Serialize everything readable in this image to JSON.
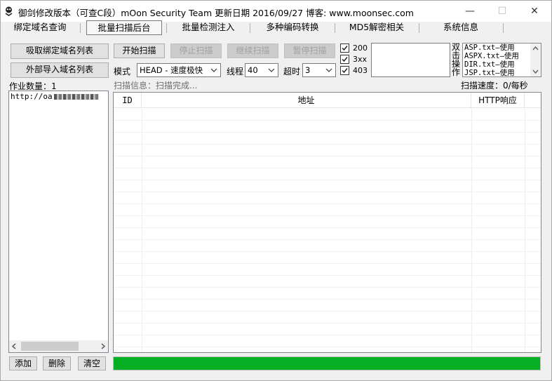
{
  "window": {
    "title": "御剑修改版本（可查C段）mOon Security Team 更新日期 2016/09/27 博客: www.moonsec.com",
    "controls": {
      "minimize": "—",
      "maximize": "☐",
      "close": "✕"
    }
  },
  "tabs": [
    {
      "label": "绑定域名查询",
      "active": false
    },
    {
      "label": "批量扫描后台",
      "active": true
    },
    {
      "label": "批量检测注入",
      "active": false
    },
    {
      "label": "多种编码转换",
      "active": false
    },
    {
      "label": "MD5解密相关",
      "active": false
    },
    {
      "label": "系统信息",
      "active": false
    }
  ],
  "left_panel": {
    "fetch_button": "吸取绑定域名列表",
    "import_button": "外部导入域名列表",
    "job_count_label": "作业数量：1",
    "domain_list": [
      "http://oa..."
    ],
    "add_button": "添加",
    "delete_button": "删除",
    "clear_button": "清空"
  },
  "scan_controls": {
    "start_button": "开始扫描",
    "stop_button": "停止扫描",
    "resume_button": "继续扫描",
    "pause_button": "暂停扫描",
    "mode_label": "模式",
    "mode_value": "HEAD - 速度极快",
    "threads_label": "线程",
    "threads_value": "40",
    "timeout_label": "超时",
    "timeout_value": "3"
  },
  "status_codes": [
    {
      "label": "200",
      "checked": true
    },
    {
      "label": "3xx",
      "checked": true
    },
    {
      "label": "403",
      "checked": true
    }
  ],
  "dict_panel": {
    "hint": "双击操作",
    "items": [
      "ASP.txt—使用",
      "ASPX.txt—使用",
      "DIR.txt—使用",
      "JSP.txt—使用"
    ]
  },
  "scan_info": "扫描信息：扫描完成...",
  "scan_speed": "扫描速度：0/每秒",
  "results_table": {
    "columns": [
      "ID",
      "地址",
      "HTTP响应"
    ],
    "rows": []
  },
  "progress": {
    "fraction": 1.0
  }
}
